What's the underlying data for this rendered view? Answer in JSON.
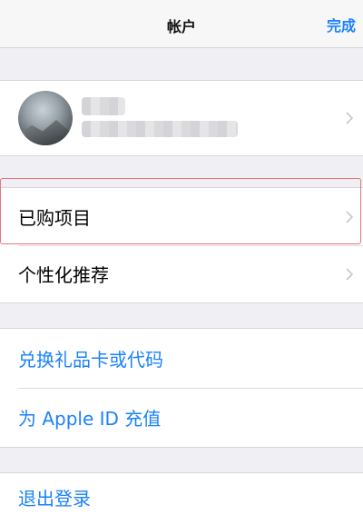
{
  "navbar": {
    "title": "帐户",
    "done_label": "完成"
  },
  "profile": {
    "avatar_icon": "avatar-mountain-image",
    "name_hidden": true
  },
  "menu1": {
    "purchased": "已购项目",
    "personalized": "个性化推荐"
  },
  "menu2": {
    "redeem": "兑换礼品卡或代码",
    "add_funds": "为 Apple ID 充值"
  },
  "menu3": {
    "sign_out": "退出登录"
  },
  "colors": {
    "accent": "#1a82fb",
    "highlight": "#e8747a",
    "background": "#efeff4"
  }
}
